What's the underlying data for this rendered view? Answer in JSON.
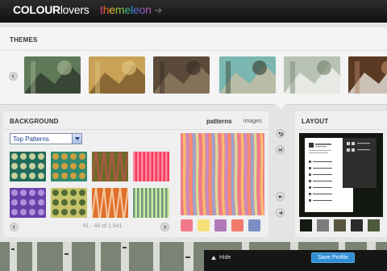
{
  "header": {
    "logo": {
      "bold": "COLOUR",
      "light": "lovers"
    },
    "product_letters": [
      {
        "ch": "t",
        "color": "#d83d8f"
      },
      {
        "ch": "h",
        "color": "#e26b2f"
      },
      {
        "ch": "e",
        "color": "#f0b43a"
      },
      {
        "ch": "m",
        "color": "#8cc43c"
      },
      {
        "ch": "e",
        "color": "#3fb38c"
      },
      {
        "ch": "l",
        "color": "#2a9ad0"
      },
      {
        "ch": "e",
        "color": "#5a6ed0"
      },
      {
        "ch": "o",
        "color": "#8a5bc6"
      },
      {
        "ch": "n",
        "color": "#b15bb8"
      }
    ]
  },
  "themes": {
    "title": "THEMES",
    "thumbnails": [
      {
        "name": "theme-thumb-leaves-sky",
        "colors": [
          "#5f7a59",
          "#2e3a2c",
          "#9fb08f"
        ]
      },
      {
        "name": "theme-thumb-golden-trees",
        "colors": [
          "#c9a257",
          "#7a5a2c",
          "#e0c480"
        ]
      },
      {
        "name": "theme-thumb-shoes",
        "colors": [
          "#5b4a3a",
          "#8d7a60",
          "#3c3026"
        ]
      },
      {
        "name": "theme-thumb-doll",
        "colors": [
          "#7bb6b0",
          "#c7bfa5",
          "#3e4c3a"
        ]
      },
      {
        "name": "theme-thumb-birch-trees",
        "colors": [
          "#b8c2b4",
          "#f2f2f0",
          "#7c8a76"
        ]
      },
      {
        "name": "theme-thumb-coffee",
        "colors": [
          "#5b3a24",
          "#e9e3dc",
          "#b08060"
        ]
      }
    ]
  },
  "background": {
    "title": "BACKGROUND",
    "tab_patterns": "patterns",
    "tab_images": "images",
    "select_value": "Top Patterns",
    "pager": "41 - 48 of 1,541",
    "patterns": [
      {
        "name": "pattern-teal-burst",
        "bg": "#1f6b5c",
        "fg": "#e7e0a8"
      },
      {
        "name": "pattern-green-fish",
        "bg": "#2f8a6f",
        "fg": "#e8a23a"
      },
      {
        "name": "pattern-olive-stripes",
        "bg": "#6f6b2a",
        "fg": "#b1574a"
      },
      {
        "name": "pattern-pink-stripes",
        "bg": "#f03c5c",
        "fg": "#ff8aa0"
      },
      {
        "name": "pattern-purple-lace",
        "bg": "#6a3fa8",
        "fg": "#b9a0e6"
      },
      {
        "name": "pattern-green-branches",
        "bg": "#c6c36a",
        "fg": "#3d5a2c"
      },
      {
        "name": "pattern-orange-dots",
        "bg": "#e0702c",
        "fg": "#f5c9a0"
      },
      {
        "name": "pattern-mint-circles",
        "bg": "#cfe8a6",
        "fg": "#6b9a7a"
      }
    ],
    "preview_colors": [
      "#f07a8a",
      "#f7c36a",
      "#c58fc4",
      "#f6906a",
      "#8eaad6",
      "#d6e29a"
    ],
    "swatches": [
      "#f07a8a",
      "#f7e27a",
      "#b07ab8",
      "#f27a6a",
      "#7a8fc4"
    ]
  },
  "layout": {
    "title": "LAYOUT",
    "swatches": [
      "#141a12",
      "#7c7c7c",
      "#58563e",
      "#2c2c2c",
      "#4e5a3c"
    ]
  },
  "bottom_bar": {
    "hide_label": "Hide",
    "save_label": "Save Profile"
  }
}
